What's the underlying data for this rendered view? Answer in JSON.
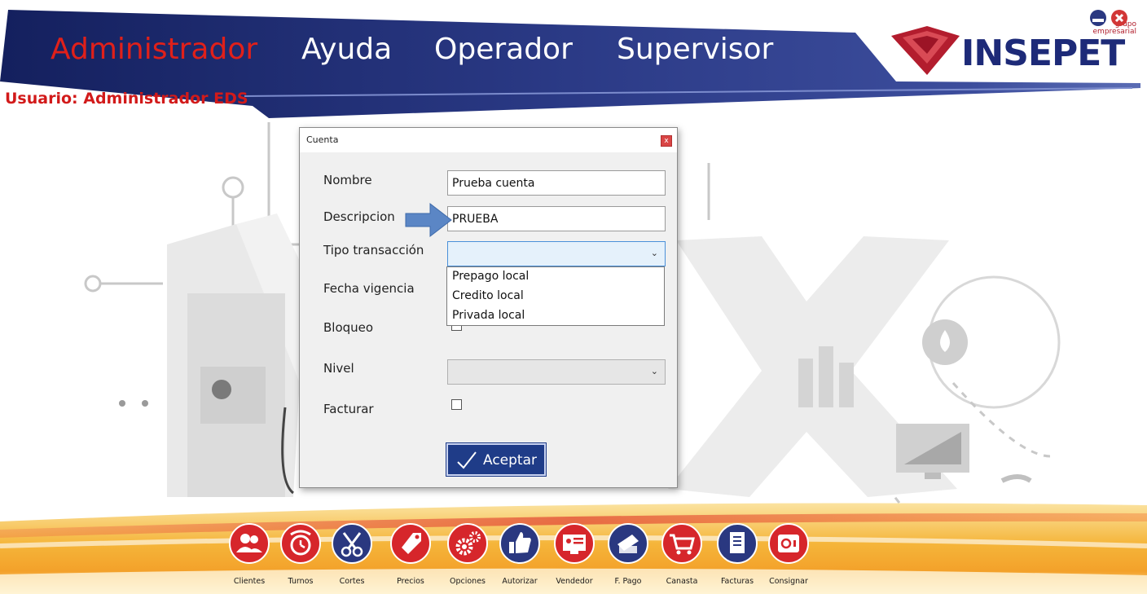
{
  "header": {
    "menu": [
      {
        "label": "Administrador",
        "color": "#e0201a"
      },
      {
        "label": "Ayuda",
        "color": "#ffffff"
      },
      {
        "label": "Operador",
        "color": "#ffffff"
      },
      {
        "label": "Supervisor",
        "color": "#ffffff"
      }
    ],
    "user_label": "Usuario: Administrador EDS",
    "logo": {
      "name": "INSEPET",
      "subtitle_line1": "grupo",
      "subtitle_line2": "empresarial"
    },
    "window_buttons": [
      {
        "name": "minimize-icon",
        "color": "#2a3880"
      },
      {
        "name": "close-icon",
        "color": "#d23636"
      }
    ]
  },
  "dialog": {
    "title": "Cuenta",
    "close_label": "x",
    "fields": {
      "nombre": {
        "label": "Nombre",
        "value": "Prueba cuenta"
      },
      "descripcion": {
        "label": "Descripcion",
        "value": "PRUEBA"
      },
      "tipo_transaccion": {
        "label": "Tipo transacción",
        "value": "",
        "arrow": "⌄",
        "options": [
          "Prepago local",
          "Credito local",
          "Privada local"
        ]
      },
      "fecha_vigencia": {
        "label": "Fecha vigencia"
      },
      "bloqueo": {
        "label": "Bloqueo",
        "checked": false
      },
      "nivel": {
        "label": "Nivel",
        "value": "",
        "arrow": "⌄"
      },
      "facturar": {
        "label": "Facturar",
        "checked": false
      }
    },
    "accept_label": "Aceptar"
  },
  "toolbar": {
    "items": [
      {
        "label": "Clientes",
        "icon": "users-icon",
        "color": "#d6262b"
      },
      {
        "label": "Turnos",
        "icon": "alarm-clock-icon",
        "color": "#d6262b"
      },
      {
        "label": "Cortes",
        "icon": "scissors-icon",
        "color": "#2a3880"
      },
      {
        "label": "Precios",
        "icon": "price-tag-icon",
        "color": "#d6262b"
      },
      {
        "label": "Opciones",
        "icon": "gears-icon",
        "color": "#d6262b"
      },
      {
        "label": "Autorizar",
        "icon": "thumbs-up-icon",
        "color": "#2a3880"
      },
      {
        "label": "Vendedor",
        "icon": "id-card-icon",
        "color": "#d6262b"
      },
      {
        "label": "F. Pago",
        "icon": "payment-icon",
        "color": "#2a3880"
      },
      {
        "label": "Canasta",
        "icon": "cart-icon",
        "color": "#d6262b"
      },
      {
        "label": "Facturas",
        "icon": "invoice-icon",
        "color": "#2a3880"
      },
      {
        "label": "Consignar",
        "icon": "safe-icon",
        "color": "#d6262b"
      }
    ]
  }
}
